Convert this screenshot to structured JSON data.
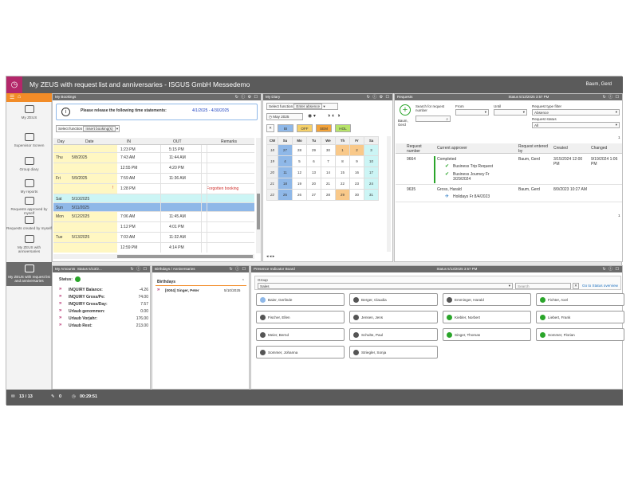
{
  "app": {
    "title": "My ZEUS with request list and anniversaries - ISGUS GmbH Messedemo",
    "user": "Baum, Gerd"
  },
  "colors": {
    "brand": "#b3276a",
    "accent": "#f28c28",
    "header": "#6b6b6b",
    "selected": "#8fb8e8",
    "green": "#2aa52a"
  },
  "sidebar": {
    "items": [
      {
        "label": "My ZEUS",
        "icon": "person-icon"
      },
      {
        "label": "Supervisor Screen",
        "icon": "group-icon"
      },
      {
        "label": "Group diary",
        "icon": "calendar-icon"
      },
      {
        "label": "My reports",
        "icon": "report-icon"
      },
      {
        "label": "Requests approved by myself",
        "icon": "list-icon"
      },
      {
        "label": "Requests created by myself",
        "icon": "list-icon"
      },
      {
        "label": "My ZEUS with anniversaries",
        "icon": "person-icon"
      },
      {
        "label": "My ZEUS with request list and anniversaries",
        "icon": "person-icon"
      }
    ]
  },
  "bookings": {
    "title": "My Bookings",
    "notice": "Please release the following time statements:",
    "period": "4/1/2025 - 4/30/2025",
    "select_function_label": "Select function",
    "select_function_value": "Insert booking(s)",
    "columns": [
      "Day",
      "Date",
      "IN",
      "OUT",
      "Remarks"
    ],
    "rows": [
      {
        "day": "",
        "date": "",
        "in": "1:23 PM",
        "out": "5:15 PM",
        "remarks": ""
      },
      {
        "day": "Thu",
        "date": "5/8/2025",
        "in": "7:43 AM",
        "out": "11:44 AM",
        "remarks": ""
      },
      {
        "day": "",
        "date": "",
        "in": "12:55 PM",
        "out": "4:20 PM",
        "remarks": ""
      },
      {
        "day": "Fri",
        "date": "5/9/2025",
        "in": "7:59 AM",
        "out": "11:36 AM",
        "remarks": ""
      },
      {
        "day": "",
        "date": "",
        "in": "1:28 PM",
        "out": "",
        "remarks": "Forgotten booking"
      },
      {
        "day": "Sat",
        "date": "5/10/2025",
        "in": "",
        "out": "",
        "remarks": ""
      },
      {
        "day": "Sun",
        "date": "5/11/2025",
        "in": "",
        "out": "",
        "remarks": ""
      },
      {
        "day": "Mon",
        "date": "5/12/2025",
        "in": "7:06 AM",
        "out": "11:45 AM",
        "remarks": ""
      },
      {
        "day": "",
        "date": "",
        "in": "1:12 PM",
        "out": "4:01 PM",
        "remarks": ""
      },
      {
        "day": "Tue",
        "date": "5/13/2025",
        "in": "7:03 AM",
        "out": "11:32 AM",
        "remarks": ""
      },
      {
        "day": "",
        "date": "",
        "in": "12:59 PM",
        "out": "4:14 PM",
        "remarks": ""
      }
    ]
  },
  "diary": {
    "title": "My Diary",
    "select_function_label": "Select function",
    "select_function_value": "Enter absence",
    "month": "May 2025",
    "legend": [
      "BI",
      "OFF",
      "SEM",
      "HOL"
    ],
    "columns": [
      "CW",
      "Su",
      "Mo",
      "Tu",
      "We",
      "Th",
      "Fr",
      "Sa"
    ],
    "weeks": [
      [
        "18",
        "27",
        "28",
        "29",
        "30",
        "1",
        "2",
        "3"
      ],
      [
        "19",
        "4",
        "5",
        "6",
        "7",
        "8",
        "9",
        "10"
      ],
      [
        "20",
        "11",
        "12",
        "13",
        "14",
        "15",
        "16",
        "17"
      ],
      [
        "21",
        "18",
        "19",
        "20",
        "21",
        "22",
        "23",
        "24"
      ],
      [
        "22",
        "25",
        "26",
        "27",
        "28",
        "29",
        "30",
        "31"
      ]
    ]
  },
  "requests": {
    "title": "Requests",
    "status": "Status 5/13/2025 3:57 PM",
    "search_label": "Search for request number",
    "from_label": "From",
    "until_label": "Until",
    "type_filter_label": "Request type filter",
    "type_filter_value": "Absence",
    "status_label": "Request status",
    "status_value": "All",
    "requester": "Baum, Gerd",
    "count": "1",
    "page": "1",
    "columns": [
      "Request number",
      "Current approver",
      "Request entered by",
      "Created",
      "Changed"
    ],
    "rows": [
      {
        "number": "9664",
        "approver": "Completed",
        "entered_by": "Baum, Gerd",
        "created": "3/15/2024 12:00 PM",
        "changed": "9/19/2024 1:06 PM",
        "items": [
          "Business Trip Request",
          "Business Journey Fr 3/29/2024"
        ]
      },
      {
        "number": "9635",
        "approver": "Gross, Harald",
        "entered_by": "Baum, Gerd",
        "created": "8/9/2023 10:27 AM",
        "changed": "",
        "items": [
          "Holidays Fr 8/4/2023"
        ]
      }
    ]
  },
  "amounts": {
    "title": "My Amounts",
    "status": "Status 5/13/2...",
    "status_label": "Status:",
    "items": [
      {
        "label": "INQUIRY Balance:",
        "value": "-4.26"
      },
      {
        "label": "INQUIRY Gross/Pe:",
        "value": "74.00"
      },
      {
        "label": "INQUIRY Gross/Day:",
        "value": "7.57"
      },
      {
        "label": "Urlaub genommen:",
        "value": "0.00"
      },
      {
        "label": "Urlaub Vorjahr:",
        "value": "176.00"
      },
      {
        "label": "Urlaub Rest:",
        "value": "213.00"
      }
    ]
  },
  "birthdays": {
    "title": "Birthdays / Anniversaries",
    "section": "Birthdays",
    "entries": [
      {
        "name": "[0004] Singer, Peter",
        "date": "5/10/2025"
      }
    ]
  },
  "presence": {
    "title": "Presence Indicator Board",
    "status": "Status 5/13/2025 3:57 PM",
    "group_label": "Group",
    "group_value": "Sales",
    "search_placeholder": "Search",
    "overview_link": "Go to Status overview",
    "people": [
      {
        "name": "Baier, Gerlinde",
        "color": "#8fb8e8"
      },
      {
        "name": "Berger, Claudia",
        "color": "#555555"
      },
      {
        "name": "Emminger, Harald",
        "color": "#555555"
      },
      {
        "name": "Fichter, Axel",
        "color": "#2aa52a"
      },
      {
        "name": "Fischer, Ellen",
        "color": "#555555"
      },
      {
        "name": "Jensen, Jens",
        "color": "#555555"
      },
      {
        "name": "Kiebler, Norbert",
        "color": "#2aa52a"
      },
      {
        "name": "Liebert, Frank",
        "color": "#2aa52a"
      },
      {
        "name": "Meier, Bernd",
        "color": "#555555"
      },
      {
        "name": "Schulte, Paul",
        "color": "#555555"
      },
      {
        "name": "Singer, Thomas",
        "color": "#2aa52a"
      },
      {
        "name": "Sommer, Florian",
        "color": "#2aa52a"
      },
      {
        "name": "Sommer, Johanna",
        "color": "#555555"
      },
      {
        "name": "Striegler, Sonja",
        "color": "#555555"
      }
    ]
  },
  "statusbar": {
    "messages": "13 / 13",
    "edits": "0",
    "timer": "00:29:51"
  }
}
